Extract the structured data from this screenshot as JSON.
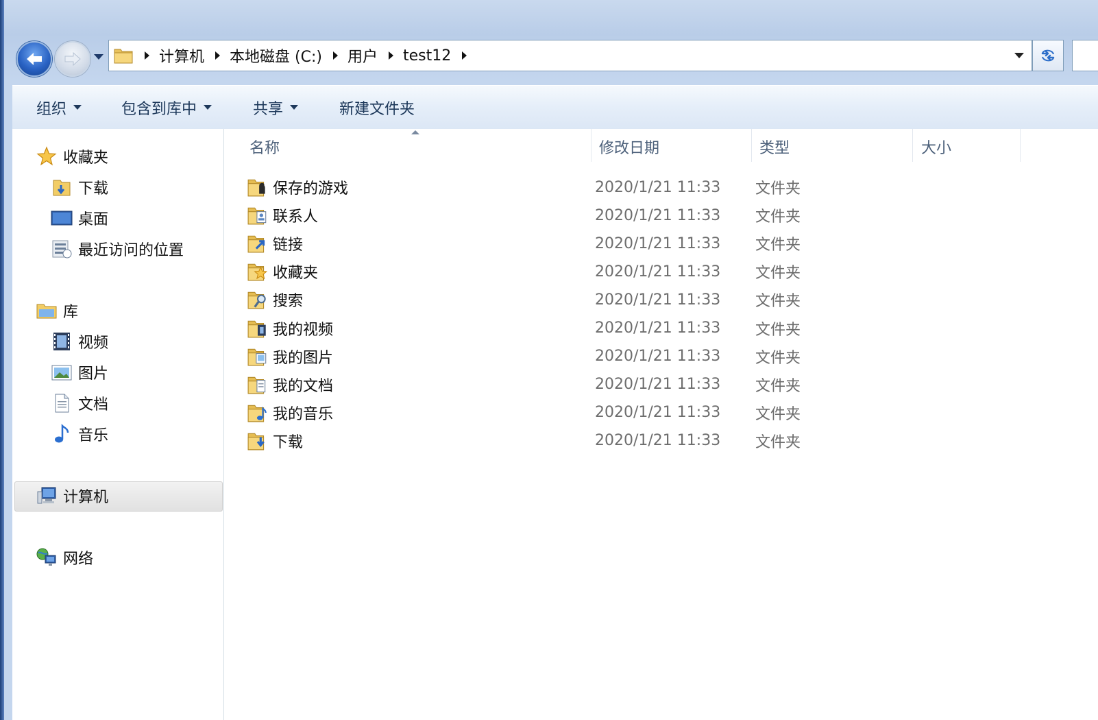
{
  "breadcrumbs": [
    "计算机",
    "本地磁盘 (C:)",
    "用户",
    "test12"
  ],
  "toolbar": {
    "organize": "组织",
    "include_in_library": "包含到库中",
    "share": "共享",
    "new_folder": "新建文件夹"
  },
  "sidebar": {
    "favorites": {
      "label": "收藏夹",
      "items": [
        {
          "label": "下载",
          "icon": "downloads-folder-icon"
        },
        {
          "label": "桌面",
          "icon": "desktop-icon"
        },
        {
          "label": "最近访问的位置",
          "icon": "recent-places-icon"
        }
      ]
    },
    "libraries": {
      "label": "库",
      "items": [
        {
          "label": "视频",
          "icon": "video-library-icon"
        },
        {
          "label": "图片",
          "icon": "pictures-library-icon"
        },
        {
          "label": "文档",
          "icon": "documents-library-icon"
        },
        {
          "label": "音乐",
          "icon": "music-library-icon"
        }
      ]
    },
    "computer": {
      "label": "计算机"
    },
    "network": {
      "label": "网络"
    }
  },
  "columns": {
    "name": "名称",
    "modified": "修改日期",
    "type": "类型",
    "size": "大小"
  },
  "files": [
    {
      "name": "保存的游戏",
      "modified": "2020/1/21 11:33",
      "type": "文件夹",
      "size": "",
      "icon": "saved-games-folder-icon"
    },
    {
      "name": "联系人",
      "modified": "2020/1/21 11:33",
      "type": "文件夹",
      "size": "",
      "icon": "contacts-folder-icon"
    },
    {
      "name": "链接",
      "modified": "2020/1/21 11:33",
      "type": "文件夹",
      "size": "",
      "icon": "links-folder-icon"
    },
    {
      "name": "收藏夹",
      "modified": "2020/1/21 11:33",
      "type": "文件夹",
      "size": "",
      "icon": "favorites-folder-icon"
    },
    {
      "name": "搜索",
      "modified": "2020/1/21 11:33",
      "type": "文件夹",
      "size": "",
      "icon": "searches-folder-icon"
    },
    {
      "name": "我的视频",
      "modified": "2020/1/21 11:33",
      "type": "文件夹",
      "size": "",
      "icon": "videos-folder-icon"
    },
    {
      "name": "我的图片",
      "modified": "2020/1/21 11:33",
      "type": "文件夹",
      "size": "",
      "icon": "pictures-folder-icon"
    },
    {
      "name": "我的文档",
      "modified": "2020/1/21 11:33",
      "type": "文件夹",
      "size": "",
      "icon": "documents-folder-icon"
    },
    {
      "name": "我的音乐",
      "modified": "2020/1/21 11:33",
      "type": "文件夹",
      "size": "",
      "icon": "music-folder-icon"
    },
    {
      "name": "下载",
      "modified": "2020/1/21 11:33",
      "type": "文件夹",
      "size": "",
      "icon": "downloads-folder-icon"
    }
  ]
}
